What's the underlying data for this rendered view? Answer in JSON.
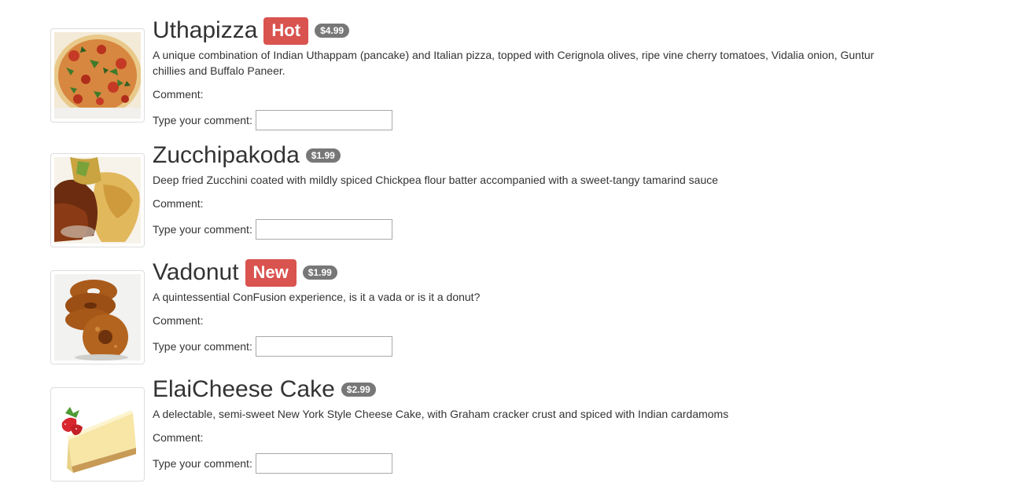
{
  "comment_label": "Comment:",
  "comment_prompt": "Type your comment:",
  "dishes": [
    {
      "name": "Uthapizza",
      "label": "Hot",
      "price": "$4.99",
      "description": "A unique combination of Indian Uthappam (pancake) and Italian pizza, topped with Cerignola olives, ripe vine cherry tomatoes, Vidalia onion, Guntur chillies and Buffalo Paneer.",
      "comment_value": "",
      "image_icon": "pizza-image"
    },
    {
      "name": "Zucchipakoda",
      "label": "",
      "price": "$1.99",
      "description": "Deep fried Zucchini coated with mildly spiced Chickpea flour batter accompanied with a sweet-tangy tamarind sauce",
      "comment_value": "",
      "image_icon": "pakoda-image"
    },
    {
      "name": "Vadonut",
      "label": "New",
      "price": "$1.99",
      "description": "A quintessential ConFusion experience, is it a vada or is it a donut?",
      "comment_value": "",
      "image_icon": "vadonut-image"
    },
    {
      "name": "ElaiCheese Cake",
      "label": "",
      "price": "$2.99",
      "description": "A delectable, semi-sweet New York Style Cheese Cake, with Graham cracker crust and spiced with Indian cardamoms",
      "comment_value": "",
      "image_icon": "cheesecake-image"
    }
  ],
  "colors": {
    "label_bg": "#d9534f",
    "badge_bg": "#777777",
    "text": "#333333"
  }
}
